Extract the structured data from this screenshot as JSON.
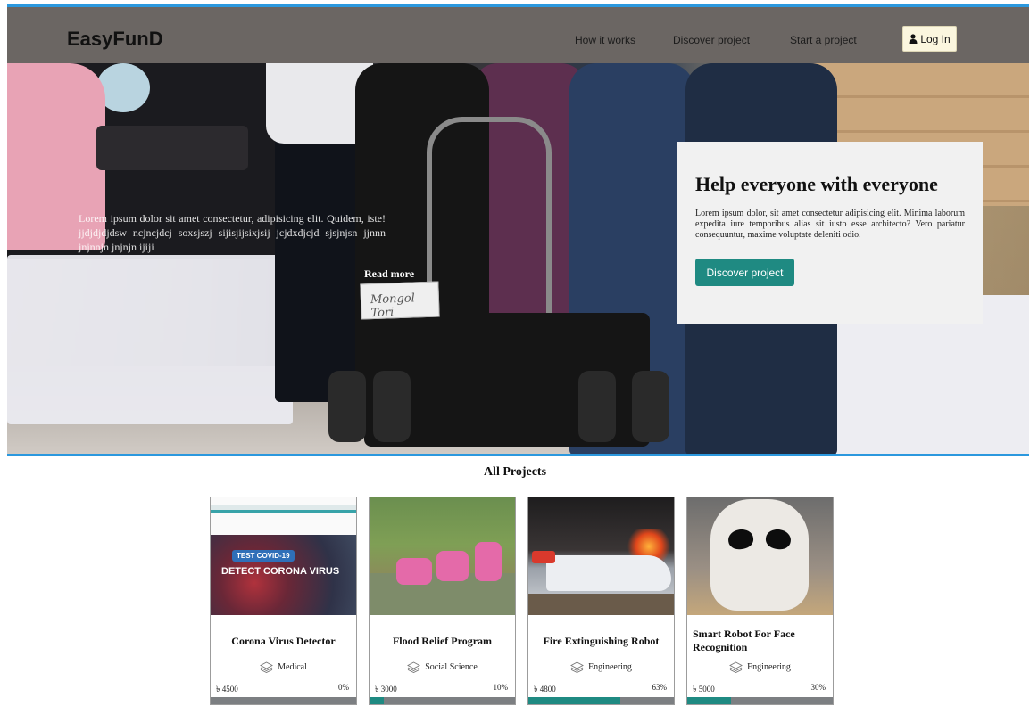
{
  "header": {
    "brand": "EasyFunD",
    "nav": [
      "How it works",
      "Discover project",
      "Start a project"
    ],
    "login_label": "Log In"
  },
  "hero": {
    "paragraph": "Lorem ipsum dolor sit amet consectetur, adipisicing elit. Quidem, iste! jjdjdjdjdsw ncjncjdcj soxsjszj sijisjijsixjsij jcjdxdjcjd sjsjnjsn jjnnn jnjnnjn jnjnjn ijiji",
    "read_more": "Read more",
    "sign_text": "Mongol Tori",
    "card": {
      "title": "Help everyone with everyone",
      "text": "Lorem ipsum dolor, sit amet consectetur adipisicing elit. Minima laborum expedita iure temporibus alias sit iusto esse architecto? Vero pariatur consequuntur, maxime voluptate deleniti odio.",
      "button": "Discover project"
    }
  },
  "projects": {
    "title": "All Projects",
    "items": [
      {
        "title": "Corona Virus Detector",
        "category": "Medical",
        "amount": "৳ 4500",
        "percent_label": "0%",
        "progress": 0,
        "image_tag": "TEST COVID-19",
        "image_headline": "DETECT CORONA VIRUS"
      },
      {
        "title": "Flood Relief Program",
        "category": "Social Science",
        "amount": "৳ 3000",
        "percent_label": "10%",
        "progress": 10
      },
      {
        "title": "Fire Extinguishing Robot",
        "category": "Engineering",
        "amount": "৳ 4800",
        "percent_label": "63%",
        "progress": 63
      },
      {
        "title": "Smart Robot For Face Recognition",
        "category": "Engineering",
        "amount": "৳ 5000",
        "percent_label": "30%",
        "progress": 30
      }
    ]
  },
  "colors": {
    "header_bg": "#6b6663",
    "accent_line": "#2b98de",
    "teal": "#1f8a82",
    "progress_track": "#7c7f82"
  },
  "icons": {
    "login": "user-icon",
    "category": "layers-icon"
  }
}
